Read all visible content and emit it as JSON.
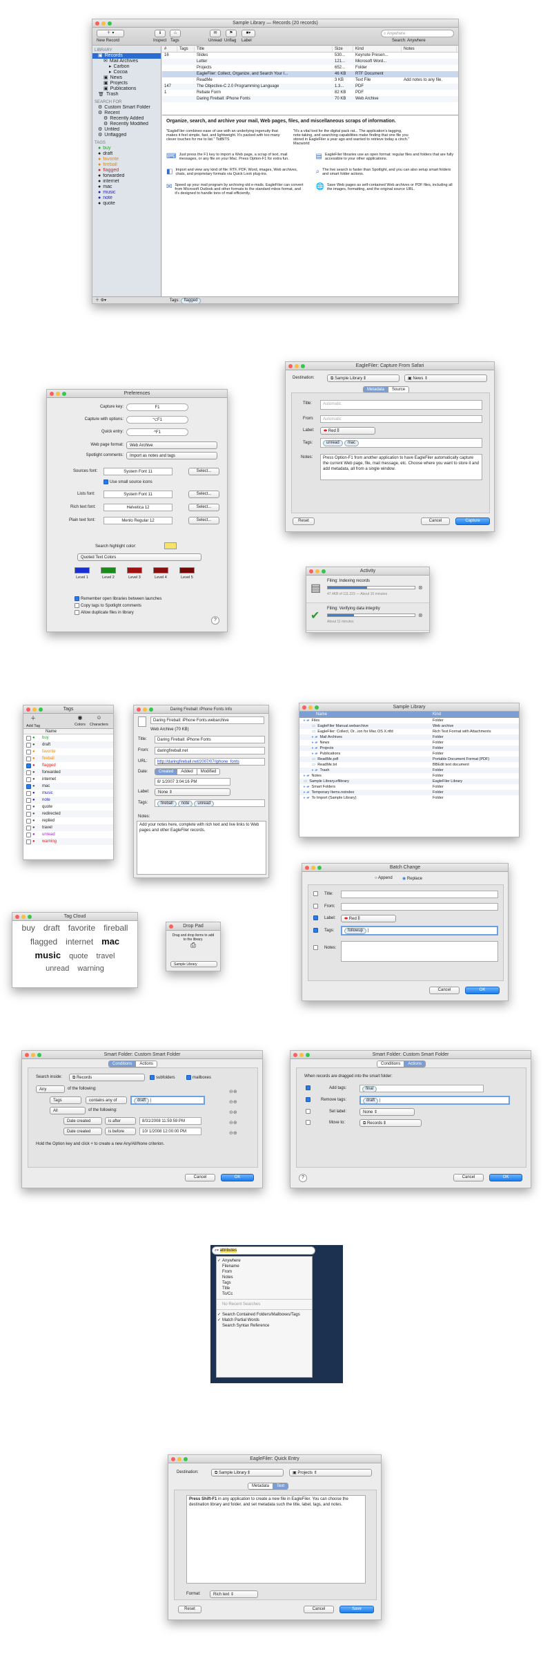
{
  "main": {
    "title": "Sample Library — Records (20 records)",
    "toolbar": [
      "New Record",
      "Inspect",
      "Tags",
      "Unread",
      "Unflag",
      "Label"
    ],
    "search_placeholder": "Anywhere",
    "search_scope": "Search: Anywhere",
    "sidebar_head_library": "LIBRARY",
    "sidebar_library": [
      "Records",
      "Mail Archives",
      "Carbon",
      "Cocoa",
      "News",
      "Projects",
      "Publications",
      "Trash"
    ],
    "sidebar_head_search": "SEARCH FOR",
    "sidebar_search": [
      "Custom Smart Folder",
      "Recent",
      "Recently Added",
      "Recently Modified",
      "Unfiled",
      "Unflagged"
    ],
    "sidebar_head_tags": "TAGS",
    "sidebar_tags": [
      "buy",
      "draft",
      "favorite",
      "fireball",
      "flagged",
      "forwarded",
      "internet",
      "mac",
      "music",
      "note",
      "quote"
    ],
    "columns": [
      "#",
      "Tags",
      "Title",
      "Size",
      "Kind",
      "Notes"
    ],
    "rows": [
      [
        "16",
        "",
        "Slides",
        "530...",
        "Keynote Presen..."
      ],
      [
        "",
        "",
        "Letter",
        "121...",
        "Microsoft Word..."
      ],
      [
        "",
        "",
        "Projects",
        "652...",
        "Folder"
      ],
      [
        "",
        "",
        "EagleFiler: Collect, Organize, and Search Your I...",
        "46 KB",
        "RTF Document"
      ],
      [
        "",
        "",
        "ReadMe",
        "3 KB",
        "Text File",
        "Add notes to any file."
      ],
      [
        "147",
        "",
        "The Objective-C 2.0 Programming Language",
        "1.3...",
        "PDF"
      ],
      [
        "1",
        "",
        "Rebate Form",
        "82 KB",
        "PDF"
      ],
      [
        "",
        "",
        "Daring Fireball: iPhone Fonts",
        "70 KB",
        "Web Archive"
      ]
    ],
    "doc_heading": "Organize, search, and archive your mail, Web pages, files, and miscellaneous scraps of information.",
    "quote1": "\"EagleFiler combines ease of use with an underlying ingenuity that makes it feel simple, fast, and lightweight. It's packed with too many clever touches for me to list.\" TidBITS",
    "quote2": "\"It's a vital tool for the digital pack rat... The application's tagging, note-taking, and searching capabilities make finding that one file you stored in EagleFiler a year ago and wanted to retrieve today a cinch.\" Macworld",
    "features": [
      "Just press the F1 key to import a Web page, a scrap of text, mail messages, or any file on your Mac. Press Option-F1 for extra fun.",
      "EagleFiler libraries use an open format: regular files and folders that are fully accessible to your other applications.",
      "Import and view any kind of file: RTF, PDF, Word, images, Web archives, chats, and proprietary formats via Quick Look plug-ins.",
      "The live search is faster than Spotlight, and you can also setup smart folders and smart folder actions.",
      "Speed up your mail program by archiving old e-mails. EagleFiler can convert from Microsoft Outlook and other formats to the standard mbox format, and it's designed to handle tons of mail efficiently.",
      "Save Web pages as self-contained Web archives or PDF files, including all the images, formatting, and the original source URL."
    ],
    "status_tags_label": "Tags:",
    "status_tag": "flagged"
  },
  "capture": {
    "title": "EagleFiler: Capture From Safari",
    "dest_label": "Destination:",
    "library": "Sample Library",
    "folder": "News",
    "tabs": [
      "Metadata",
      "Source"
    ],
    "title_label": "Title:",
    "title_ph": "Automatic",
    "from_label": "From:",
    "from_ph": "Automatic",
    "label_label": "Label:",
    "label_val": "Red",
    "tags_label": "Tags:",
    "tags": [
      "unread",
      "mac"
    ],
    "notes_label": "Notes:",
    "notes": "Press Option-F1 from another application to have EagleFiler automatically capture the current Web page, file, mail message, etc. Choose where you want to store it and add metadata, all from a single window.",
    "reset": "Reset",
    "cancel": "Cancel",
    "ok": "Capture"
  },
  "prefs": {
    "title": "Preferences",
    "rows": [
      [
        "Capture key:",
        "F1"
      ],
      [
        "Capture with options:",
        "⌥F1"
      ],
      [
        "Quick entry:",
        "^F1"
      ]
    ],
    "web_label": "Web page format:",
    "web_val": "Web Archive",
    "spot_label": "Spotlight comments:",
    "spot_val": "Import as notes and tags",
    "sources_label": "Sources font:",
    "sources_val": "System Font 11",
    "small_icons": "Use small source icons",
    "lists_label": "Lists font:",
    "lists_val": "System Font 11",
    "rich_label": "Rich text font:",
    "rich_val": "Helvetica 12",
    "plain_label": "Plain text font:",
    "plain_val": "Menlo Regular 12",
    "select": "Select...",
    "highlight_label": "Search highlight color:",
    "quoted": "Quoted Text Colors",
    "levels": [
      "Level 1",
      "Level 2",
      "Level 3",
      "Level 4",
      "Level 5"
    ],
    "level_colors": [
      "#1a2fd0",
      "#1a8a1a",
      "#a01010",
      "#8a1010",
      "#700a0a"
    ],
    "checks": [
      "Remember open libraries between launches",
      "Copy tags to Spotlight comments",
      "Allow duplicate files in library"
    ]
  },
  "activity": {
    "title": "Activity",
    "items": [
      {
        "name": "Filing: Indexing records",
        "detail": "47.4KB of 111.223 — About 10 minutes",
        "progress": 0.45
      },
      {
        "name": "Filing: Verifying data integrity",
        "detail": "About 11 minutes",
        "progress": 0.3
      }
    ]
  },
  "tags": {
    "title": "Tags",
    "toolbar": [
      "Add Tag",
      "Colors",
      "Characters"
    ],
    "col": "Name",
    "list": [
      "buy",
      "draft",
      "favorite",
      "fireball",
      "flagged",
      "forwarded",
      "internet",
      "mac",
      "music",
      "note",
      "quote",
      "redirected",
      "replied",
      "travel",
      "unread",
      "warning"
    ]
  },
  "info": {
    "title": "Daring Fireball: iPhone Fonts Info",
    "file": "Daring Fireball: iPhone Fonts.webarchive",
    "kind": "Web Archive (70 KB)",
    "title_label": "Title:",
    "title_val": "Daring Fireball: iPhone Fonts",
    "from_label": "From:",
    "from_val": "daringfireball.net",
    "url_label": "URL:",
    "url_val": "http://daringfireball.net/2007/07/iphone_fonts",
    "date_label": "Date:",
    "date_tabs": [
      "Created",
      "Added",
      "Modified"
    ],
    "date_val": "8/ 1/2007  3:04:16 PM",
    "label_label": "Label:",
    "label_val": "None",
    "tags_label": "Tags:",
    "tags": [
      "fireball",
      "note",
      "unread"
    ],
    "notes_label": "Notes:",
    "notes": "Add your notes here, complete with rich text and live links to Web pages and other EagleFiler records."
  },
  "lib": {
    "title": "Sample Library",
    "cols": [
      "Name",
      "Kind"
    ],
    "rows": [
      [
        "Files",
        "Folder"
      ],
      [
        "EagleFiler Manual.webarchive",
        "Web archive"
      ],
      [
        "EagleFiler: Collect, Or...ion for Mac OS X.rtfd",
        "Rich Text Format with Attachments"
      ],
      [
        "Mail Archives",
        "Folder"
      ],
      [
        "News",
        "Folder"
      ],
      [
        "Projects",
        "Folder"
      ],
      [
        "Publications",
        "Folder"
      ],
      [
        "ReadMe.pdf",
        "Portable Document Format (PDF)"
      ],
      [
        "ReadMe.txt",
        "BBEdit text document"
      ],
      [
        "Trash",
        "Folder"
      ],
      [
        "Notes",
        "Folder"
      ],
      [
        "Sample Library.eflibrary",
        "EagleFiler Library"
      ],
      [
        "Smart Folders",
        "Folder"
      ],
      [
        "Temporary Items.noindex",
        "Folder"
      ],
      [
        "To Import (Sample Library)",
        "Folder"
      ]
    ]
  },
  "batch": {
    "title": "Batch Change",
    "modes": [
      "Append",
      "Replace"
    ],
    "fields": [
      "Title:",
      "From:",
      "Label:",
      "Tags:",
      "Notes:"
    ],
    "label_val": "Red",
    "tags_val": "followup",
    "cancel": "Cancel",
    "ok": "OK"
  },
  "cloud": {
    "title": "Tag Cloud",
    "words": [
      "buy",
      "draft",
      "favorite",
      "fireball",
      "flagged",
      "internet",
      "mac",
      "music",
      "quote",
      "travel",
      "unread",
      "warning"
    ]
  },
  "drop": {
    "title": "Drop Pad",
    "text": "Drag and drop items to add to the library.",
    "lib": "Sample Library"
  },
  "sf1": {
    "title": "Smart Folder: Custom Smart Folder",
    "tabs": [
      "Conditions",
      "Actions"
    ],
    "inside_label": "Search inside:",
    "inside_val": "Records",
    "subfolders": "subfolders",
    "mailboxes": "mailboxes",
    "any": "Any",
    "of_following": "of the following:",
    "tags": "Tags",
    "contains": "contains any of",
    "draft": "draft",
    "all": "All",
    "c1": [
      "Date created",
      "is after",
      "8/31/2008 11:59:59 PM"
    ],
    "c2": [
      "Date created",
      "is before",
      "10/ 1/2008 12:00:00 PM"
    ],
    "hint": "Hold the Option key and click + to create a new Any/All/None criterion.",
    "cancel": "Cancel",
    "ok": "OK"
  },
  "sf2": {
    "title": "Smart Folder: Custom Smart Folder",
    "tabs": [
      "Conditions",
      "Actions"
    ],
    "heading": "When records are dragged into the smart folder:",
    "add_label": "Add tags:",
    "add_val": "final",
    "rem_label": "Remove tags:",
    "rem_val": "draft",
    "setlabel_label": "Set label:",
    "setlabel_val": "None",
    "move_label": "Move to:",
    "move_val": "Records",
    "cancel": "Cancel",
    "ok": "OK"
  },
  "search": {
    "value": "attributes",
    "menu": [
      "Anywhere",
      "Filename",
      "From",
      "Notes",
      "Tags",
      "Title",
      "To/Cc"
    ],
    "recent_head": "No Recent Searches",
    "opts": [
      "Search Contained Folders/Mailboxes/Tags",
      "Match Partial Words",
      "Search Syntax Reference"
    ]
  },
  "quick": {
    "title": "EagleFiler: Quick Entry",
    "dest_label": "Destination:",
    "library": "Sample Library",
    "folder": "Projects",
    "tabs": [
      "Metadata",
      "Text"
    ],
    "bold": "Press Shift-F1",
    "text": " in any application to create a new file in EagleFiler. You can choose the destination library and folder, and set metadata such the title, label, tags, and notes.",
    "format_label": "Format:",
    "format_val": "Rich text",
    "reset": "Reset",
    "cancel": "Cancel",
    "ok": "Save"
  }
}
